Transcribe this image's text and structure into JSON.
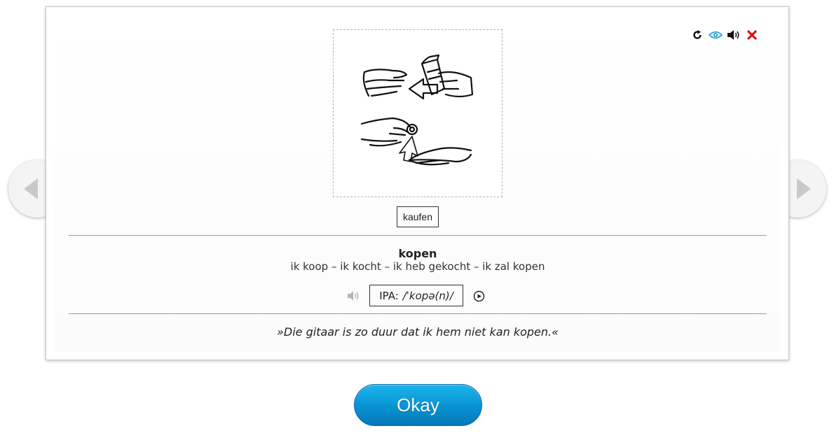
{
  "card": {
    "word_label": "kaufen",
    "headword": "kopen",
    "conjugation": "ik koop – ik kocht – ik heb gekocht – ik zal kopen",
    "ipa_prefix": "IPA:",
    "ipa_value": "/ˈkopə(n)/",
    "example": "»Die gitaar is zo duur dat ik hem niet kan kopen.«"
  },
  "toolbar": {
    "icons": [
      "refresh-icon",
      "eye-icon",
      "speaker-icon",
      "close-icon"
    ],
    "colors": {
      "refresh": "#111111",
      "eye": "#2a9fd6",
      "speaker": "#111111",
      "close": "#d9141b"
    }
  },
  "actions": {
    "okay_label": "Okay"
  },
  "colors": {
    "button_top": "#1eb4ec",
    "button_bottom": "#0578b7",
    "divider": "#9a9a9a"
  }
}
